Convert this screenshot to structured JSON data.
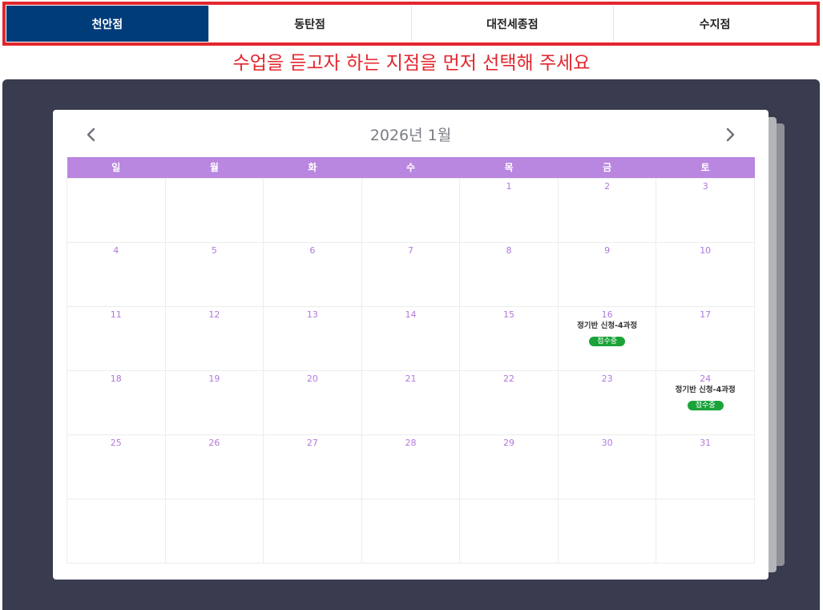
{
  "tabs": [
    {
      "label": "천안점",
      "active": true
    },
    {
      "label": "동탄점",
      "active": false
    },
    {
      "label": "대전세종점",
      "active": false
    },
    {
      "label": "수지점",
      "active": false
    }
  ],
  "notice": "수업을 듣고자 하는 지점을 먼저 선택해 주세요",
  "calendar": {
    "title": "2026년 1월",
    "weekdays": [
      "일",
      "월",
      "화",
      "수",
      "목",
      "금",
      "토"
    ],
    "weeks": [
      [
        null,
        null,
        null,
        null,
        1,
        2,
        3
      ],
      [
        4,
        5,
        6,
        7,
        8,
        9,
        10
      ],
      [
        11,
        12,
        13,
        14,
        15,
        16,
        17
      ],
      [
        18,
        19,
        20,
        21,
        22,
        23,
        24
      ],
      [
        25,
        26,
        27,
        28,
        29,
        30,
        31
      ],
      [
        null,
        null,
        null,
        null,
        null,
        null,
        null
      ]
    ],
    "events": {
      "16": {
        "title": "정기반 신청-4과정",
        "status": "접수중"
      },
      "24": {
        "title": "정기반 신청-4과정",
        "status": "접수중"
      }
    }
  },
  "icons": {
    "prev": "chevron-left-icon",
    "next": "chevron-right-icon"
  },
  "colors": {
    "tab_active": "#003c7a",
    "accent_red": "#e3262d",
    "panel_dark": "#393b4e",
    "weekday_header": "#b986e0",
    "day_number": "#b177dc",
    "badge_green": "#1ba33a"
  }
}
